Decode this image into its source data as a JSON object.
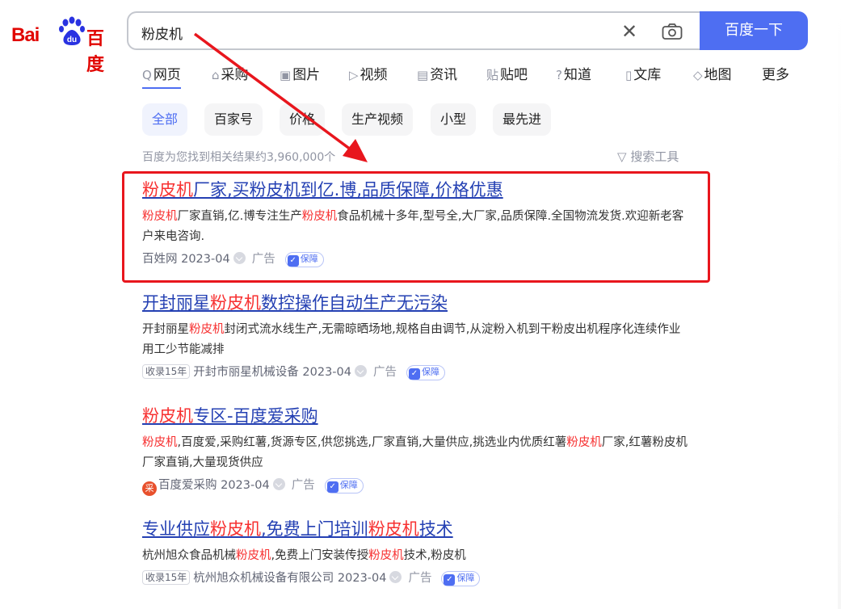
{
  "logo": {
    "bai": "Bai",
    "du": "du",
    "baidu_cn": "百度"
  },
  "search": {
    "query": "粉皮机",
    "clear": "✕",
    "button": "百度一下"
  },
  "tabs": [
    {
      "icon": "Q",
      "label": "网页"
    },
    {
      "icon": "⌂",
      "label": "采购"
    },
    {
      "icon": "▣",
      "label": "图片"
    },
    {
      "icon": "▷",
      "label": "视频"
    },
    {
      "icon": "▤",
      "label": "资讯"
    },
    {
      "icon": "贴",
      "label": "贴吧"
    },
    {
      "icon": "?",
      "label": "知道"
    },
    {
      "icon": "▯",
      "label": "文库"
    },
    {
      "icon": "◇",
      "label": "地图"
    },
    {
      "icon": "",
      "label": "更多"
    }
  ],
  "chips": [
    "全部",
    "百家号",
    "价格",
    "生产视频",
    "小型",
    "最先进"
  ],
  "result_info": "百度为您找到相关结果约3,960,000个",
  "search_tools": "搜索工具",
  "results": [
    {
      "title_hl": "粉皮机",
      "title_rest": "厂家,买粉皮机到亿.博,品质保障,价格优惠",
      "desc": [
        {
          "t": "粉皮机",
          "hl": true
        },
        {
          "t": "厂家直销,亿.博专注生产",
          "hl": false
        },
        {
          "t": "粉皮机",
          "hl": true
        },
        {
          "t": "食品机械十多年,型号全,大厂家,品质保障.全国物流发货.欢迎新老客户来电咨询.",
          "hl": false
        }
      ],
      "source": "百姓网 2023-04",
      "ad": "广告",
      "badge": "保障"
    },
    {
      "title_pre": "开封丽星",
      "title_hl": "粉皮机",
      "title_rest": "数控操作自动生产无污染",
      "desc": [
        {
          "t": "开封丽星",
          "hl": false
        },
        {
          "t": "粉皮机",
          "hl": true
        },
        {
          "t": "封闭式流水线生产,无需晾晒场地,规格自由调节,从淀粉入机到干粉皮出机程序化连续作业用工少节能减排",
          "hl": false
        }
      ],
      "record": "收录15年",
      "source": "开封市丽星机械设备 2023-04",
      "ad": "广告",
      "badge": "保障"
    },
    {
      "title_hl": "粉皮机",
      "title_rest": "专区-百度爱采购",
      "desc": [
        {
          "t": "粉皮机",
          "hl": true
        },
        {
          "t": ",百度爱,采购红薯,货源专区,供您挑选,厂家直销,大量供应,挑选业内优质红薯",
          "hl": false
        },
        {
          "t": "粉皮机",
          "hl": true
        },
        {
          "t": "厂家,红薯粉皮机厂家直销,大量现货供应",
          "hl": false
        }
      ],
      "store_icon": "采",
      "source": "百度爱采购 2023-04",
      "ad": "广告",
      "badge": "保障"
    },
    {
      "title_parts": [
        {
          "t": "专业供应",
          "hl": false
        },
        {
          "t": "粉皮机",
          "hl": true
        },
        {
          "t": ",免费上门培训",
          "hl": false
        },
        {
          "t": "粉皮机",
          "hl": true
        },
        {
          "t": "技术",
          "hl": false
        }
      ],
      "desc": [
        {
          "t": "杭州旭众食品机械",
          "hl": false
        },
        {
          "t": "粉皮机",
          "hl": true
        },
        {
          "t": ",免费上门安装传授",
          "hl": false
        },
        {
          "t": "粉皮机",
          "hl": true
        },
        {
          "t": "技术,粉皮机",
          "hl": false
        }
      ],
      "record": "收录15年",
      "source": "杭州旭众机械设备有限公司 2023-04",
      "ad": "广告",
      "badge": "保障"
    }
  ],
  "colors": {
    "accent": "#4e6ef2",
    "highlight": "#f73131",
    "link": "#2440b3",
    "annotation": "#e8161d"
  }
}
